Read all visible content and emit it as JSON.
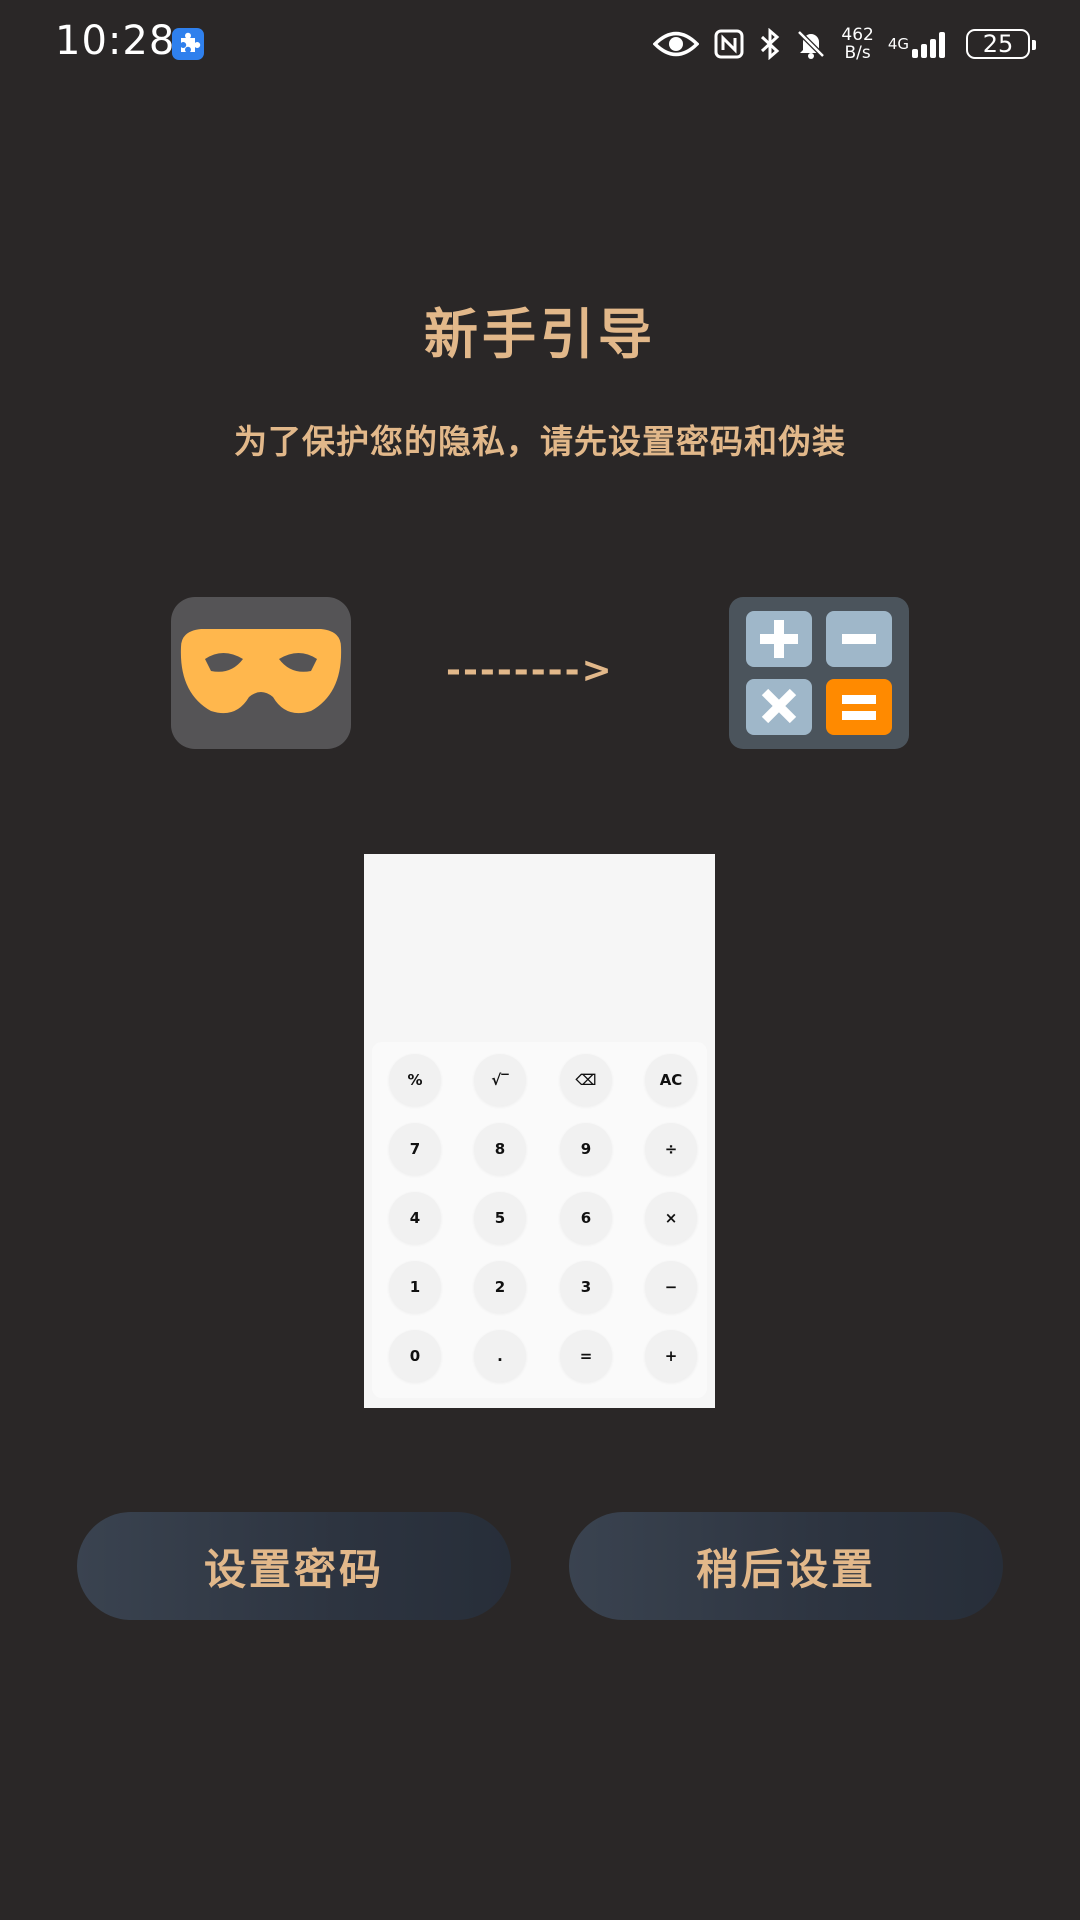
{
  "status_bar": {
    "time": "10:28",
    "net_speed_value": "462",
    "net_speed_unit": "B/s",
    "net_type": "4G",
    "battery_level": "25"
  },
  "guide": {
    "title": "新手引导",
    "subtitle": "为了保护您的隐私，请先设置密码和伪装",
    "arrow": "-------->"
  },
  "calculator": {
    "keys": [
      [
        "%",
        "√‾",
        "⌫",
        "AC"
      ],
      [
        "7",
        "8",
        "9",
        "÷"
      ],
      [
        "4",
        "5",
        "6",
        "×"
      ],
      [
        "1",
        "2",
        "3",
        "−"
      ],
      [
        "0",
        ".",
        "=",
        "+"
      ]
    ]
  },
  "actions": {
    "set_password": "设置密码",
    "set_later": "稍后设置"
  },
  "colors": {
    "background": "#2a2727",
    "accent": "#e2b88a",
    "mask": "#ffb74d",
    "calc_key": "#9fb7c9",
    "calc_equals": "#ff8a00"
  }
}
